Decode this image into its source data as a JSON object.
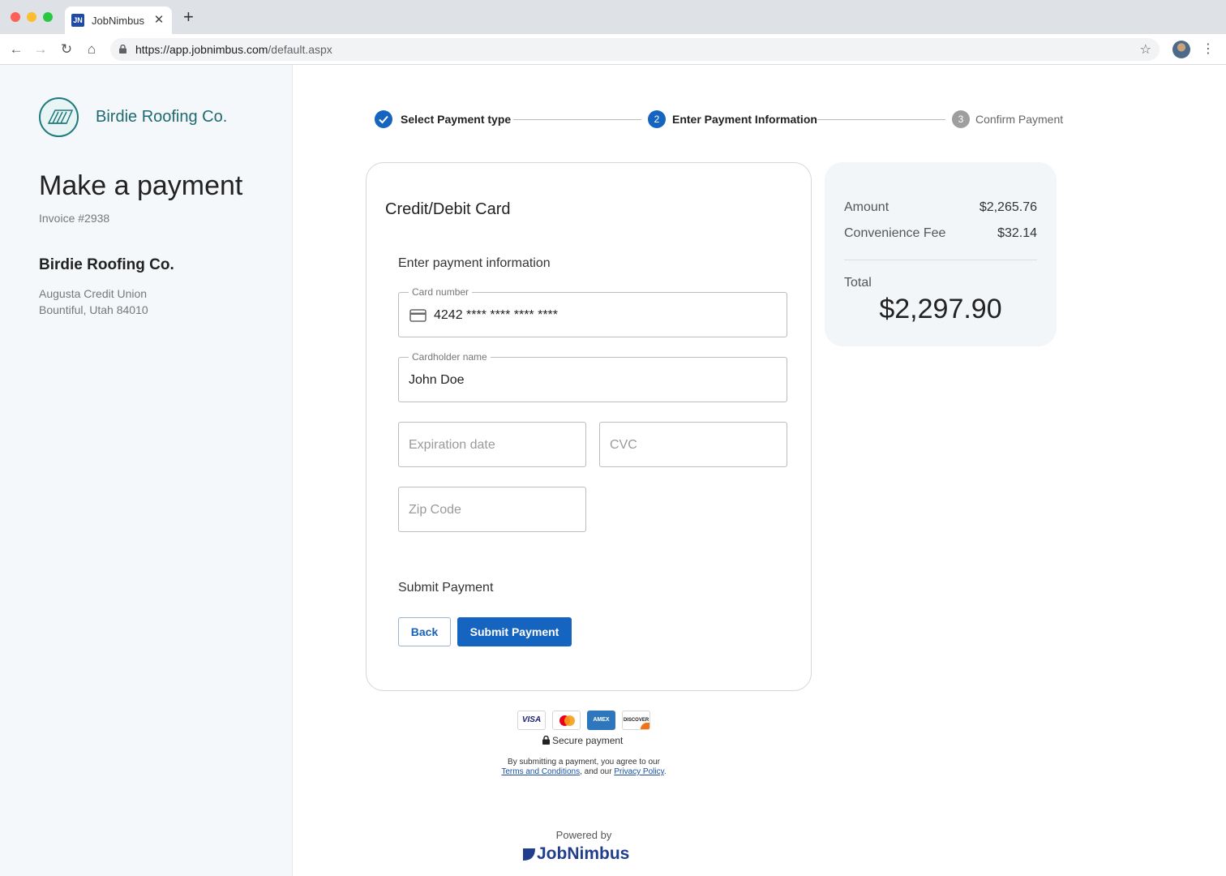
{
  "browser": {
    "tab_title": "JobNimbus",
    "favicon_text": "JN",
    "url_host": "https://app.jobnimbus.com",
    "url_path": "/default.aspx"
  },
  "sidebar": {
    "logo_name": "Birdie Roofing Co.",
    "page_title": "Make a payment",
    "invoice": "Invoice #2938",
    "company_name": "Birdie Roofing Co.",
    "address_line1": "Augusta Credit Union",
    "address_line2": "Bountiful, Utah 84010"
  },
  "stepper": {
    "steps": [
      {
        "number": "1",
        "label": "Select Payment type",
        "state": "complete"
      },
      {
        "number": "2",
        "label": "Enter Payment Information",
        "state": "active"
      },
      {
        "number": "3",
        "label": "Confirm Payment",
        "state": "pending"
      }
    ]
  },
  "payment_form": {
    "title": "Credit/Debit Card",
    "section_label": "Enter payment information",
    "card_number": {
      "label": "Card number",
      "value": "4242 **** **** **** ****"
    },
    "cardholder": {
      "label": "Cardholder name",
      "value": "John Doe"
    },
    "expiration": {
      "placeholder": "Expiration date"
    },
    "cvc": {
      "placeholder": "CVC"
    },
    "zip": {
      "placeholder": "Zip Code"
    },
    "submit_heading": "Submit Payment",
    "back_label": "Back",
    "submit_label": "Submit Payment"
  },
  "summary": {
    "amount_label": "Amount",
    "amount_value": "$2,265.76",
    "fee_label": "Convenience Fee",
    "fee_value": "$32.14",
    "total_label": "Total",
    "total_value": "$2,297.90"
  },
  "footer": {
    "card_brands": [
      "VISA",
      "mastercard",
      "AMEX",
      "DISCOVER"
    ],
    "secure_text": "Secure payment",
    "legal_line1": "By submitting a payment, you agree to our",
    "terms_link": "Terms and Conditions",
    "legal_middle": ", and our ",
    "privacy_link": "Privacy Policy",
    "legal_end": ".",
    "powered_by": "Powered by",
    "brand": "JobNimbus"
  },
  "colors": {
    "primary": "#1565c0",
    "teal": "#1f6a70",
    "step_pending": "#9e9e9e"
  }
}
